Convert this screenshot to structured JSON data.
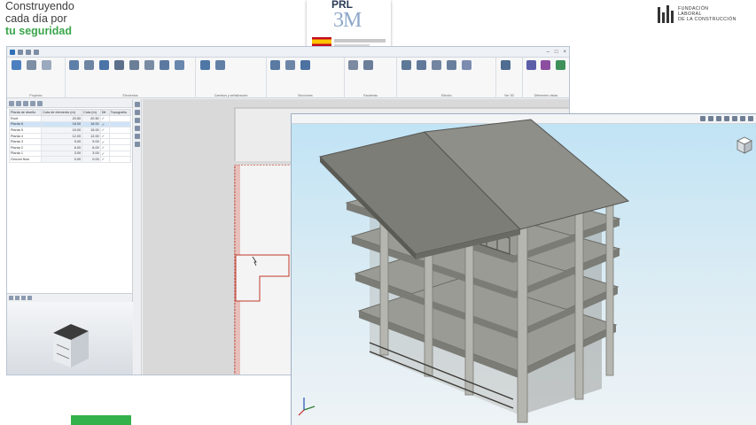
{
  "banner": {
    "tagline_line1": "Construyendo",
    "tagline_line2": "cada día por",
    "tagline_line3": "tu seguridad",
    "prl_logo_text": "PRL",
    "prl_logo_sub": "3M",
    "foundation_line1": "FUNDACIÓN",
    "foundation_line2": "LABORAL",
    "foundation_line3": "DE LA CONSTRUCCIÓN"
  },
  "colors": {
    "brand_green": "#3aa64b",
    "sky_top": "#bfe3f5",
    "concrete": "#8f8f8a",
    "roof": "#7d7d77",
    "plan_outline": "#c0392b"
  },
  "ribbon": {
    "groups": [
      "Proyecto",
      "Elementos",
      "Cambios y señalización",
      "Secciones",
      "Escaleras",
      "Edición",
      "Ver 3D",
      "Diferentes vistas"
    ]
  },
  "floor_table": {
    "headers": [
      "Planta de diseño",
      "Cota de elemento (m)",
      "Cota (m)",
      "Dif.",
      "Topografía"
    ],
    "rows": [
      [
        "Roof",
        "20.50",
        "20.50",
        "✓",
        ""
      ],
      [
        "Planta 6",
        "18.00",
        "18.00",
        "✓",
        ""
      ],
      [
        "Planta 5",
        "15.00",
        "15.00",
        "✓",
        ""
      ],
      [
        "Planta 4",
        "12.00",
        "12.00",
        "✓",
        ""
      ],
      [
        "Planta 3",
        "9.00",
        "9.00",
        "✓",
        ""
      ],
      [
        "Planta 2",
        "6.00",
        "6.00",
        "✓",
        ""
      ],
      [
        "Planta 1",
        "3.00",
        "3.00",
        "✓",
        ""
      ],
      [
        "Ground floor",
        "0.00",
        "0.00",
        "✓",
        ""
      ]
    ]
  },
  "icons": [
    "save-icon",
    "undo-icon",
    "redo-icon",
    "layers-icon",
    "navigation-cube-icon",
    "axis-gizmo-icon"
  ]
}
